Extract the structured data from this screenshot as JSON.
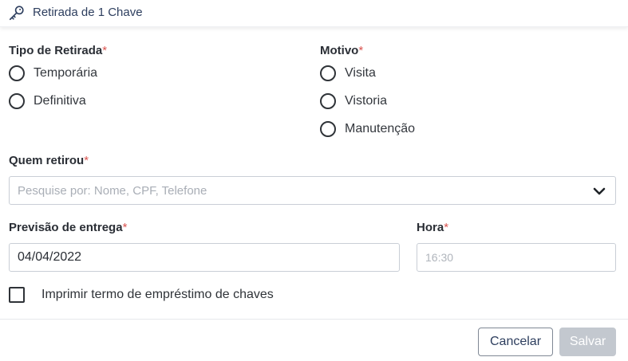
{
  "header": {
    "title": "Retirada de 1 Chave",
    "icon": "key-icon"
  },
  "form": {
    "tipo": {
      "label": "Tipo de Retirada",
      "required_mark": "*",
      "options": [
        "Temporária",
        "Definitiva"
      ]
    },
    "motivo": {
      "label": "Motivo",
      "required_mark": "*",
      "options": [
        "Visita",
        "Vistoria",
        "Manutenção"
      ]
    },
    "quem": {
      "label": "Quem retirou",
      "required_mark": "*",
      "placeholder": "Pesquise por: Nome, CPF, Telefone"
    },
    "previsao": {
      "label": "Previsão de entrega",
      "required_mark": "*",
      "value": "04/04/2022"
    },
    "hora": {
      "label": "Hora",
      "required_mark": "*",
      "placeholder": "16:30"
    },
    "imprimir": {
      "label": "Imprimir termo de empréstimo de chaves",
      "checked": false
    }
  },
  "footer": {
    "cancel_label": "Cancelar",
    "save_label": "Salvar"
  },
  "colors": {
    "required": "#d9534f",
    "title": "#2d3e5e",
    "disabled_button": "#c3c8cf"
  }
}
